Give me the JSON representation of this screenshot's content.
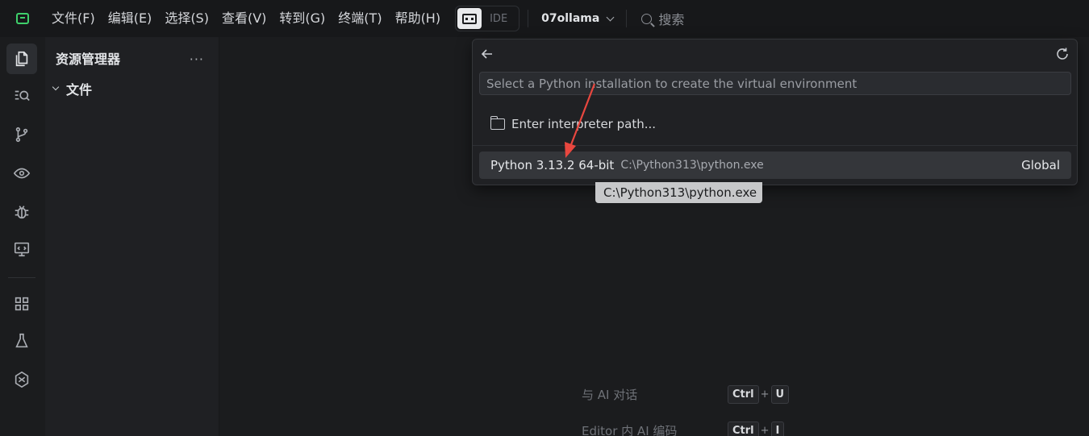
{
  "menu": [
    "文件(F)",
    "编辑(E)",
    "选择(S)",
    "查看(V)",
    "转到(G)",
    "终端(T)",
    "帮助(H)"
  ],
  "mode": {
    "ide_label": "IDE"
  },
  "workspace": "07ollama",
  "search_label": "搜索",
  "sidebar": {
    "title": "资源管理器",
    "more": "···",
    "folder": "文件"
  },
  "quickpick": {
    "placeholder": "Select a Python installation to create the virtual environment",
    "enter_path": "Enter interpreter path...",
    "item": {
      "label": "Python 3.13.2 64-bit",
      "description": "C:\\Python313\\python.exe",
      "detail": "Global"
    }
  },
  "tooltip": "C:\\Python313\\python.exe",
  "shortcuts": [
    {
      "label": "与 AI 对话",
      "keys": [
        "Ctrl",
        "U"
      ]
    },
    {
      "label": "Editor 内 AI 编码",
      "keys": [
        "Ctrl",
        "I"
      ]
    }
  ],
  "icons": {
    "activity": [
      "files-icon",
      "search-icon",
      "source-control-icon",
      "preview-icon",
      "debug-icon",
      "remote-icon",
      "extensions-icon",
      "testing-icon",
      "ai-icon"
    ]
  },
  "colors": {
    "accent": "#3ecf6b",
    "annotation": "#e8473f"
  }
}
